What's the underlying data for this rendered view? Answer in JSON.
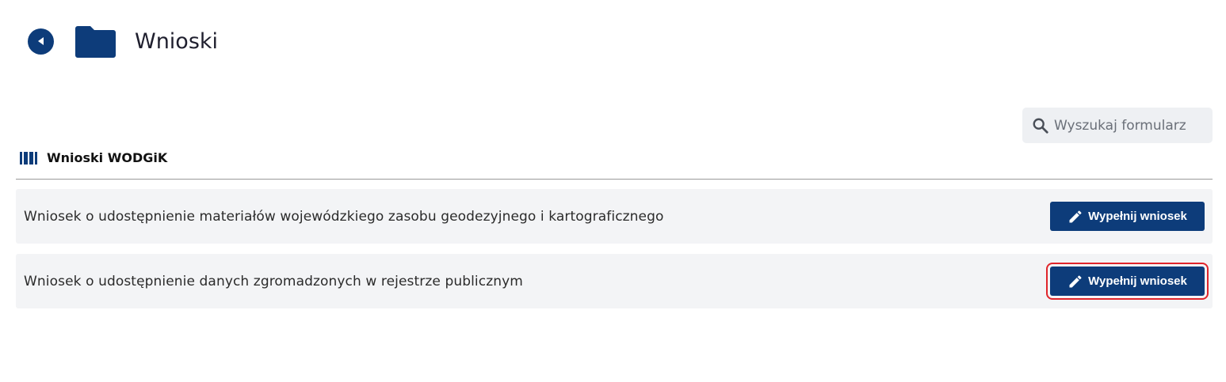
{
  "header": {
    "title": "Wnioski",
    "back_icon": "back-arrow-icon",
    "folder_icon": "folder-icon"
  },
  "search": {
    "placeholder": "Wyszukaj formularz",
    "value": "",
    "icon": "search-icon"
  },
  "section": {
    "title": "Wnioski WODGiK",
    "icon": "book-icon"
  },
  "forms": [
    {
      "label": "Wniosek o udostępnienie materiałów wojewódzkiego zasobu geodezyjnego i kartograficznego",
      "button_label": "Wypełnij wniosek"
    },
    {
      "label": "Wniosek o udostępnienie danych zgromadzonych w rejestrze publicznym",
      "button_label": "Wypełnij wniosek"
    }
  ],
  "colors": {
    "primary": "#0d3c7a",
    "row_background": "#f3f4f6",
    "search_background": "#eef0f3",
    "highlight": "#e0252b"
  }
}
